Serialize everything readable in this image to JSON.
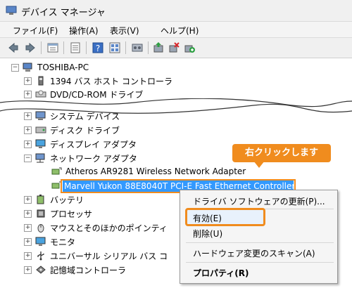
{
  "window": {
    "title": "デバイス マネージャ"
  },
  "menu": [
    "ファイル(F)",
    "操作(A)",
    "表示(V)",
    "ヘルプ(H)"
  ],
  "toolbar": [
    "back-icon",
    "forward-icon",
    "properties-icon",
    "list-icon",
    "help-icon",
    "view-icon",
    "hardware-icon",
    "update-driver-icon",
    "uninstall-icon",
    "enable-device-icon"
  ],
  "tree": {
    "root": "TOSHIBA-PC",
    "items": [
      "1394 バス ホスト コントローラ",
      "DVD/CD-ROM ドライブ",
      "システム デバイス",
      "ディスク ドライブ",
      "ディスプレイ アダプタ",
      "ネットワーク アダプタ",
      "Atheros AR9281 Wireless Network Adapter",
      "Marvell Yukon 88E8040T PCI-E Fast Ethernet Controller",
      "バッテリ",
      "プロセッサ",
      "マウスとそのほかのポインティ",
      "モニタ",
      "ユニバーサル シリアル バス コ",
      "記憶域コントローラ"
    ]
  },
  "callout": "右クリックします",
  "context_menu": {
    "update": "ドライバ ソフトウェアの更新(P)...",
    "enable": "有効(E)",
    "delete": "削除(U)",
    "scan": "ハードウェア変更のスキャン(A)",
    "properties": "プロパティ(R)"
  },
  "colors": {
    "accent": "#f08c1e",
    "selection": "#3399ff"
  }
}
